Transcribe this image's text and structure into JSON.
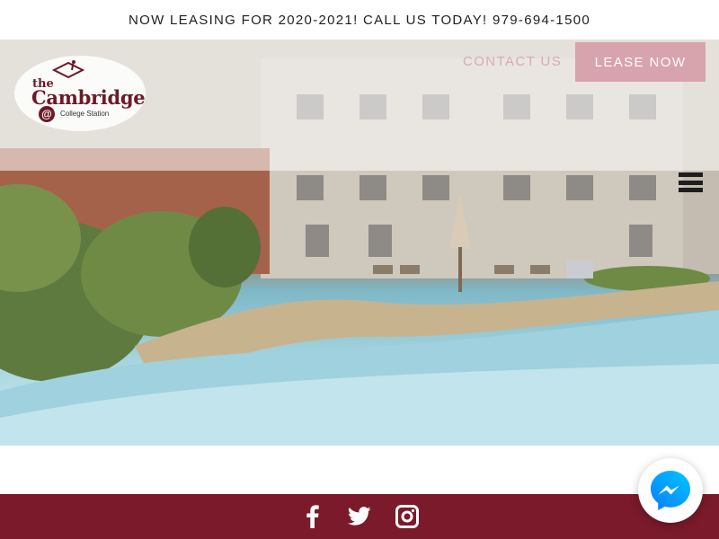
{
  "announcement": {
    "text": "NOW LEASING FOR 2020-2021! CALL US TODAY! 979-694-1500"
  },
  "logo": {
    "the": "the",
    "name": "Cambridge",
    "at": "@",
    "location": "College Station"
  },
  "nav": {
    "contact_label": "CONTACT US",
    "lease_label": "LEASE NOW"
  },
  "hero": {
    "image": "apartment courtyard with pool"
  },
  "social": [
    "facebook-icon",
    "twitter-icon",
    "instagram-icon"
  ],
  "colors": {
    "brand": "#7a1a2a",
    "lease_button": "#d7a3ad",
    "contact_link": "#d9a9b1",
    "messenger": "#0a7cff"
  }
}
